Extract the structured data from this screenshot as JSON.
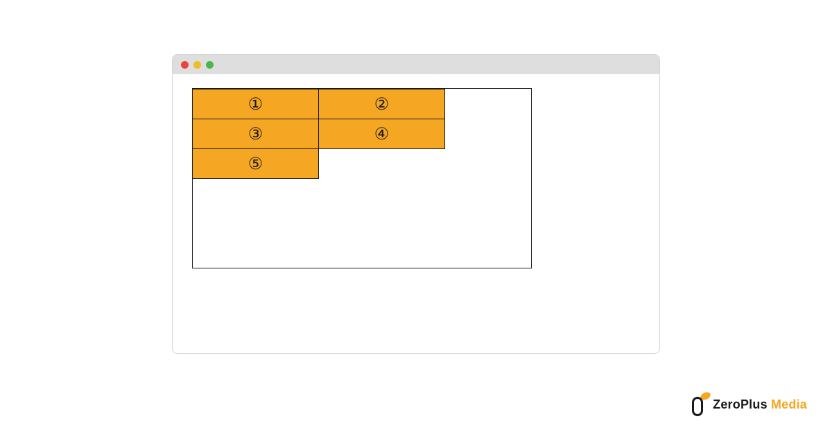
{
  "items": [
    {
      "label": "①"
    },
    {
      "label": "②"
    },
    {
      "label": "③"
    },
    {
      "label": "④"
    },
    {
      "label": "⑤"
    }
  ],
  "logo": {
    "brand_primary": "ZeroPlus",
    "brand_secondary": "Media"
  },
  "colors": {
    "item_bg": "#f5a623",
    "border": "#1a1a1a",
    "titlebar": "#dedede"
  }
}
